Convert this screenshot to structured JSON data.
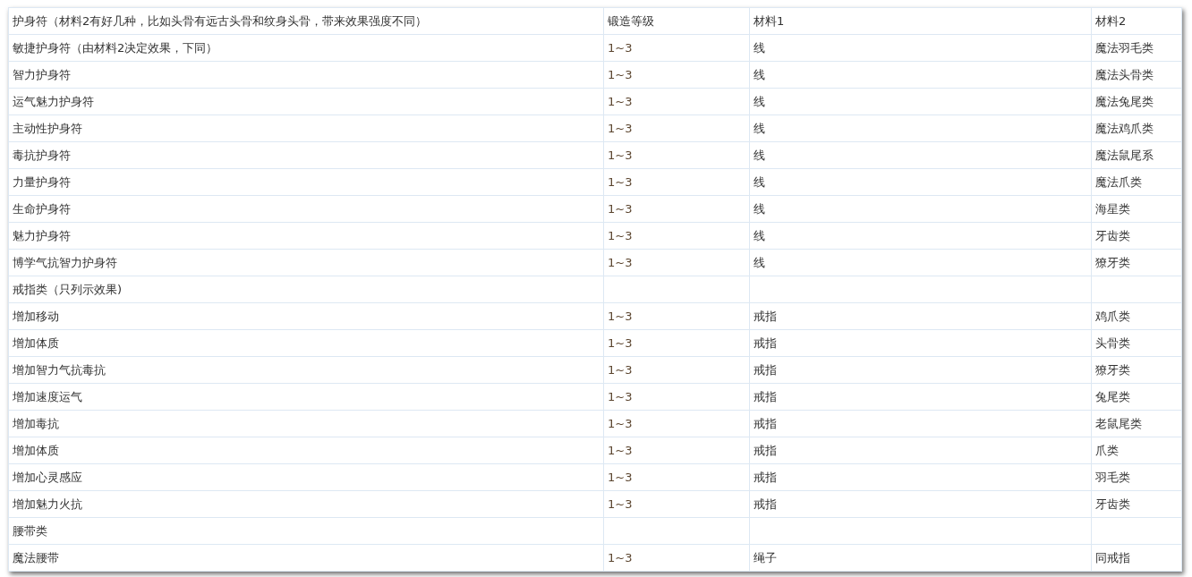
{
  "table": {
    "columns": [
      "护身符（材料2有好几种，比如头骨有远古头骨和纹身头骨，带来效果强度不同）",
      "锻造等级",
      "材料1",
      "材料2"
    ],
    "rows": [
      {
        "name": "敏捷护身符（由材料2决定效果，下同）",
        "level": "1~3",
        "material_1": "线",
        "material_2": "魔法羽毛类"
      },
      {
        "name": "智力护身符",
        "level": "1~3",
        "material_1": "线",
        "material_2": "魔法头骨类"
      },
      {
        "name": "运气魅力护身符",
        "level": "1~3",
        "material_1": "线",
        "material_2": "魔法兔尾类"
      },
      {
        "name": "主动性护身符",
        "level": "1~3",
        "material_1": "线",
        "material_2": "魔法鸡爪类"
      },
      {
        "name": "毒抗护身符",
        "level": "1~3",
        "material_1": "线",
        "material_2": "魔法鼠尾系"
      },
      {
        "name": "力量护身符",
        "level": "1~3",
        "material_1": "线",
        "material_2": "魔法爪类"
      },
      {
        "name": "生命护身符",
        "level": "1~3",
        "material_1": "线",
        "material_2": "海星类"
      },
      {
        "name": "魅力护身符",
        "level": "1~3",
        "material_1": "线",
        "material_2": "牙齿类"
      },
      {
        "name": "博学气抗智力护身符",
        "level": "1~3",
        "material_1": "线",
        "material_2": "獠牙类"
      },
      {
        "name": "戒指类（只列示效果)"
      },
      {
        "name": "增加移动",
        "level": "1~3",
        "material_1": "戒指",
        "material_2": "鸡爪类"
      },
      {
        "name": "增加体质",
        "level": "1~3",
        "material_1": "戒指",
        "material_2": "头骨类"
      },
      {
        "name": "增加智力气抗毒抗",
        "level": "1~3",
        "material_1": "戒指",
        "material_2": "獠牙类"
      },
      {
        "name": "增加速度运气",
        "level": "1~3",
        "material_1": "戒指",
        "material_2": "兔尾类"
      },
      {
        "name": "增加毒抗",
        "level": "1~3",
        "material_1": "戒指",
        "material_2": "老鼠尾类"
      },
      {
        "name": "增加体质",
        "level": "1~3",
        "material_1": "戒指",
        "material_2": "爪类"
      },
      {
        "name": "增加心灵感应",
        "level": "1~3",
        "material_1": "戒指",
        "material_2": "羽毛类"
      },
      {
        "name": "增加魅力火抗",
        "level": "1~3",
        "material_1": "戒指",
        "material_2": "牙齿类"
      },
      {
        "name": "腰带类"
      },
      {
        "name": "魔法腰带",
        "level": "1~3",
        "material_1": "绳子",
        "material_2": "同戒指"
      }
    ]
  }
}
